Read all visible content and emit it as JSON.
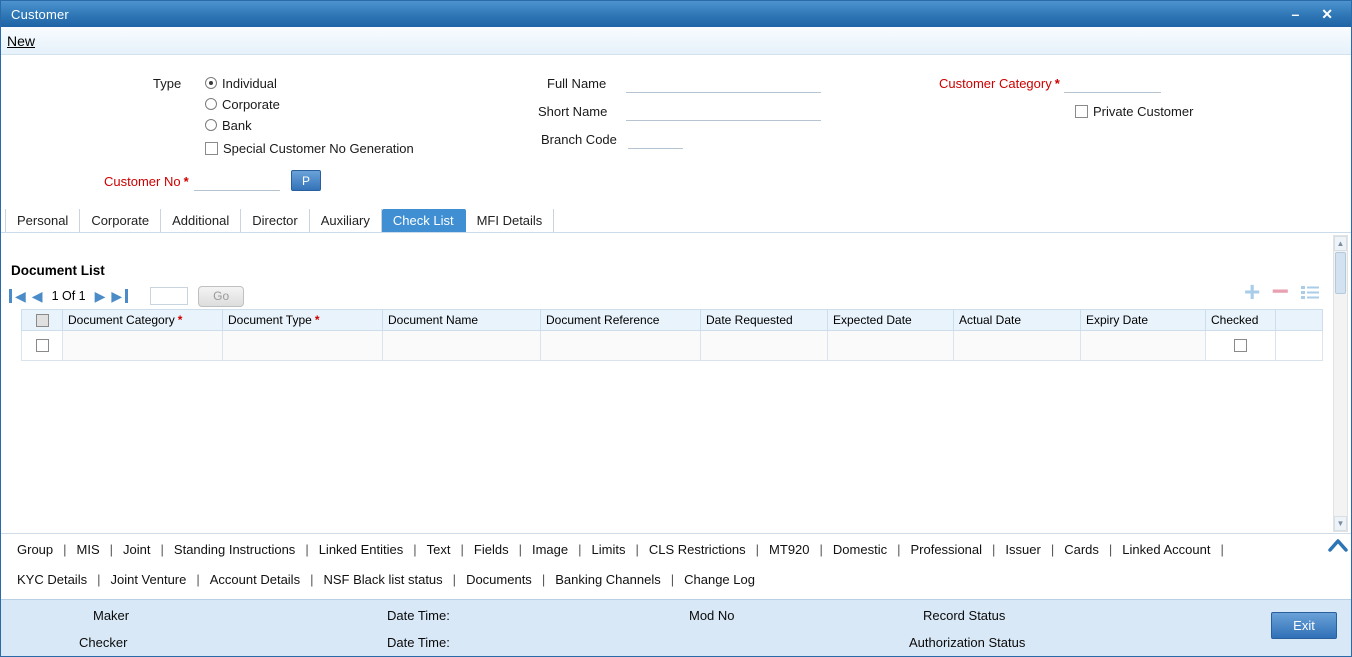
{
  "window": {
    "title": "Customer"
  },
  "icons": {
    "minimize": "–",
    "close": "✕",
    "first_page": "◀",
    "prev_page": "◀",
    "next_page": "▶",
    "last_page": "▶",
    "add": "+",
    "remove": "−",
    "scroll_up": "▲",
    "scroll_down": "▼"
  },
  "menubar": {
    "new_label": "New"
  },
  "form": {
    "type": {
      "label": "Type",
      "options": [
        {
          "label": "Individual",
          "selected": true
        },
        {
          "label": "Corporate",
          "selected": false
        },
        {
          "label": "Bank",
          "selected": false
        }
      ]
    },
    "special_no_gen": {
      "label": "Special Customer No Generation",
      "checked": false
    },
    "customer_no": {
      "label": "Customer No",
      "required": "*",
      "value": "",
      "p_button_label": "P"
    },
    "full_name": {
      "label": "Full Name",
      "value": ""
    },
    "short_name": {
      "label": "Short Name",
      "value": ""
    },
    "branch_code": {
      "label": "Branch Code",
      "value": ""
    },
    "customer_category": {
      "label": "Customer Category",
      "required": "*",
      "value": ""
    },
    "private_customer": {
      "label": "Private Customer",
      "checked": false
    }
  },
  "tabs": [
    {
      "label": "Personal",
      "active": false
    },
    {
      "label": "Corporate",
      "active": false
    },
    {
      "label": "Additional",
      "active": false
    },
    {
      "label": "Director",
      "active": false
    },
    {
      "label": "Auxiliary",
      "active": false
    },
    {
      "label": "Check List",
      "active": true
    },
    {
      "label": "MFI Details",
      "active": false
    }
  ],
  "document_list": {
    "title": "Document List",
    "pagination": {
      "page_text": "1 Of 1",
      "page_input_value": "",
      "go_label": "Go"
    },
    "columns": [
      {
        "label": "Document Category",
        "required": "*"
      },
      {
        "label": "Document Type",
        "required": "*"
      },
      {
        "label": "Document Name",
        "required": ""
      },
      {
        "label": "Document Reference",
        "required": ""
      },
      {
        "label": "Date Requested",
        "required": ""
      },
      {
        "label": "Expected Date",
        "required": ""
      },
      {
        "label": "Actual Date",
        "required": ""
      },
      {
        "label": "Expiry Date",
        "required": ""
      },
      {
        "label": "Checked",
        "required": ""
      }
    ],
    "rows": [
      {
        "document_category": "",
        "document_type": "",
        "document_name": "",
        "document_reference": "",
        "date_requested": "",
        "expected_date": "",
        "actual_date": "",
        "expiry_date": "",
        "checked": false
      }
    ]
  },
  "links": {
    "separator": "|",
    "row1": [
      "Group",
      "MIS",
      "Joint",
      "Standing Instructions",
      "Linked Entities",
      "Text",
      "Fields",
      "Image",
      "Limits",
      "CLS Restrictions",
      "MT920",
      "Domestic",
      "Professional",
      "Issuer",
      "Cards",
      "Linked Account"
    ],
    "row2": [
      "KYC Details",
      "Joint Venture",
      "Account Details",
      "NSF Black list status",
      "Documents",
      "Banking Channels",
      "Change Log"
    ]
  },
  "footer": {
    "maker_label": "Maker",
    "checker_label": "Checker",
    "date_time_label": "Date Time:",
    "mod_no_label": "Mod No",
    "record_status_label": "Record Status",
    "authorization_status_label": "Authorization Status",
    "exit_label": "Exit"
  },
  "colors": {
    "titlebar_blue": "#2f76b5",
    "accent_red": "#cc0000",
    "active_tab_blue": "#3f8fd2",
    "footer_bg": "#d9e8f6",
    "table_header_bg": "#e9f3fb"
  }
}
